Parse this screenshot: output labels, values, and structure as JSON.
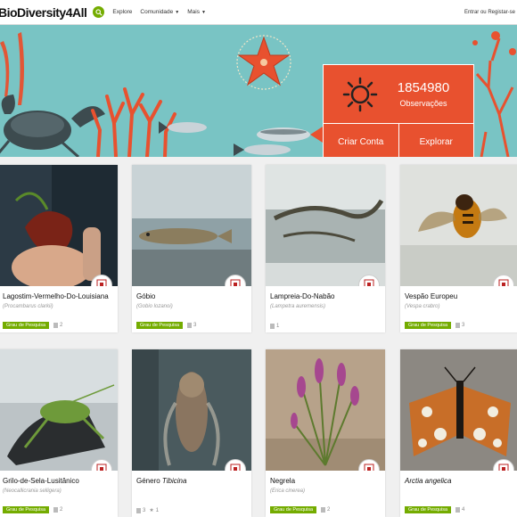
{
  "nav": {
    "logo": "BioDiversity4All",
    "links": [
      "Explore",
      "Comunidade",
      "Mais"
    ],
    "login": "Entrar ou Registar-se"
  },
  "hero": {
    "count": "1854980",
    "label": "Observações",
    "create_account": "Criar Conta",
    "explore": "Explorar"
  },
  "colors": {
    "accent": "#74ac00",
    "hero_box": "#e8512f",
    "hero_bg": "#79c4c4"
  },
  "cards": [
    {
      "title": "Lagostim-Vermelho-Do-Louisiana",
      "sci": "(Procambarus clarkii)",
      "badge": "Grau de Pesquisa",
      "comments": "2"
    },
    {
      "title": "Góbio",
      "sci": "(Gobio lozanoi)",
      "badge": "Grau de Pesquisa",
      "comments": "3"
    },
    {
      "title": "Lampreia-Do-Nabão",
      "sci": "(Lampetra auremensis)",
      "badge": "",
      "comments": "1"
    },
    {
      "title": "Vespão Europeu",
      "sci": "(Vespa crabro)",
      "badge": "Grau de Pesquisa",
      "comments": "3"
    },
    {
      "title": "Grilo-de-Sela-Lusitânico",
      "sci": "(Neocallicrania selligera)",
      "badge": "Grau de Pesquisa",
      "comments": "2"
    },
    {
      "title_prefix": "Género ",
      "title_em": "Tibicina",
      "sci": "",
      "badge": "",
      "comments": "3",
      "faves": "1"
    },
    {
      "title": "Negrela",
      "sci": "(Erica cinerea)",
      "badge": "Grau de Pesquisa",
      "comments": "2"
    },
    {
      "title_em": "Arctia angelica",
      "sci": "",
      "badge": "Grau de Pesquisa",
      "comments": "4"
    }
  ]
}
